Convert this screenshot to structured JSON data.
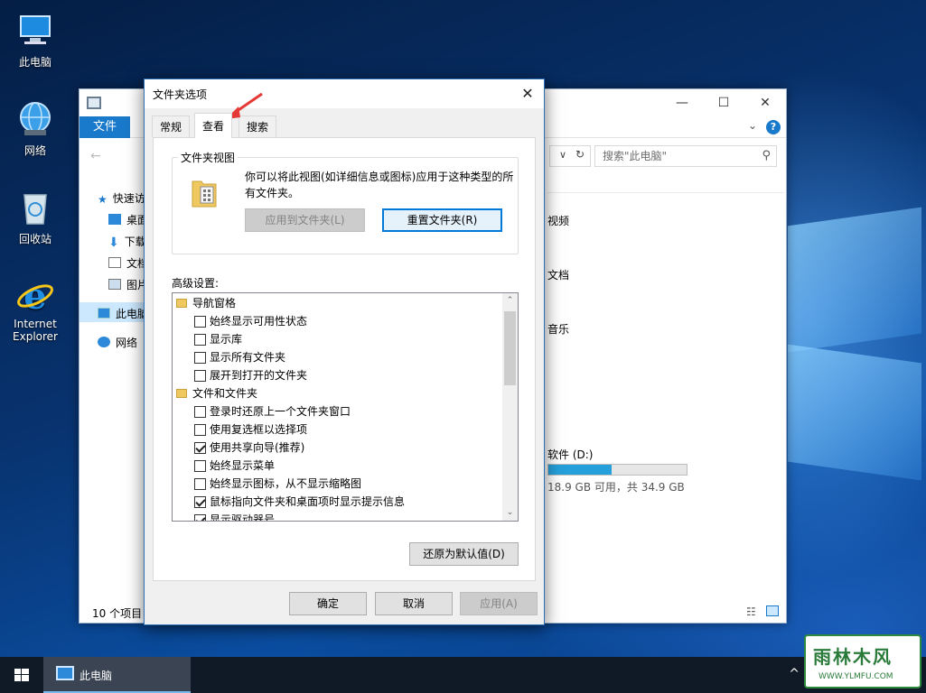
{
  "desktop": {
    "icons": [
      {
        "label": "此电脑",
        "icon": "computer-icon"
      },
      {
        "label": "网络",
        "icon": "network-globe-icon"
      },
      {
        "label": "回收站",
        "icon": "recycle-bin-icon"
      },
      {
        "label_line1": "Internet",
        "label_line2": "Explorer",
        "icon": "internet-explorer-icon"
      }
    ]
  },
  "explorer": {
    "file_tab": "文件",
    "search_placeholder": "搜索\"此电脑\"",
    "nav": [
      {
        "label": "快速访",
        "icon": "star-icon"
      },
      {
        "label": "桌面",
        "icon": "desktop-icon"
      },
      {
        "label": "下载",
        "icon": "download-arrow-icon"
      },
      {
        "label": "文档",
        "icon": "document-icon"
      },
      {
        "label": "图片",
        "icon": "picture-icon"
      },
      {
        "label": "此电脑",
        "icon": "computer-icon"
      },
      {
        "label": "网络",
        "icon": "network-icon"
      }
    ],
    "folders": [
      "视频",
      "文档",
      "音乐"
    ],
    "drive": {
      "label": "软件 (D:)",
      "free_text": "18.9 GB 可用，共 34.9 GB",
      "used_fraction": 0.46
    },
    "status": "10 个项目",
    "colors": {
      "accent": "#1979ca",
      "drive_fill": "#26a0da"
    }
  },
  "dialog": {
    "title": "文件夹选项",
    "close": "✕",
    "tabs": [
      {
        "label": "常规",
        "active": false
      },
      {
        "label": "查看",
        "active": true
      },
      {
        "label": "搜索",
        "active": false
      }
    ],
    "folder_view": {
      "legend": "文件夹视图",
      "description": "你可以将此视图(如详细信息或图标)应用于这种类型的所有文件夹。",
      "apply_button": "应用到文件夹(L)",
      "reset_button": "重置文件夹(R)"
    },
    "advanced_label": "高级设置:",
    "advanced_items": [
      {
        "type": "folder",
        "label": "导航窗格"
      },
      {
        "type": "checkbox",
        "label": "始终显示可用性状态",
        "checked": false
      },
      {
        "type": "checkbox",
        "label": "显示库",
        "checked": false
      },
      {
        "type": "checkbox",
        "label": "显示所有文件夹",
        "checked": false
      },
      {
        "type": "checkbox",
        "label": "展开到打开的文件夹",
        "checked": false
      },
      {
        "type": "folder",
        "label": "文件和文件夹"
      },
      {
        "type": "checkbox",
        "label": "登录时还原上一个文件夹窗口",
        "checked": false
      },
      {
        "type": "checkbox",
        "label": "使用复选框以选择项",
        "checked": false
      },
      {
        "type": "checkbox",
        "label": "使用共享向导(推荐)",
        "checked": true
      },
      {
        "type": "checkbox",
        "label": "始终显示菜单",
        "checked": false
      },
      {
        "type": "checkbox",
        "label": "始终显示图标，从不显示缩略图",
        "checked": false
      },
      {
        "type": "checkbox",
        "label": "鼠标指向文件夹和桌面项时显示提示信息",
        "checked": true
      },
      {
        "type": "checkbox",
        "label": "显示驱动器号",
        "checked": true
      }
    ],
    "restore_defaults": "还原为默认值(D)",
    "ok": "确定",
    "cancel": "取消",
    "apply": "应用(A)"
  },
  "taskbar": {
    "active_window": "此电脑",
    "tray_chevron": "^"
  },
  "watermark": {
    "brand": "雨林木风",
    "url": "WWW.YLMFU.COM"
  }
}
